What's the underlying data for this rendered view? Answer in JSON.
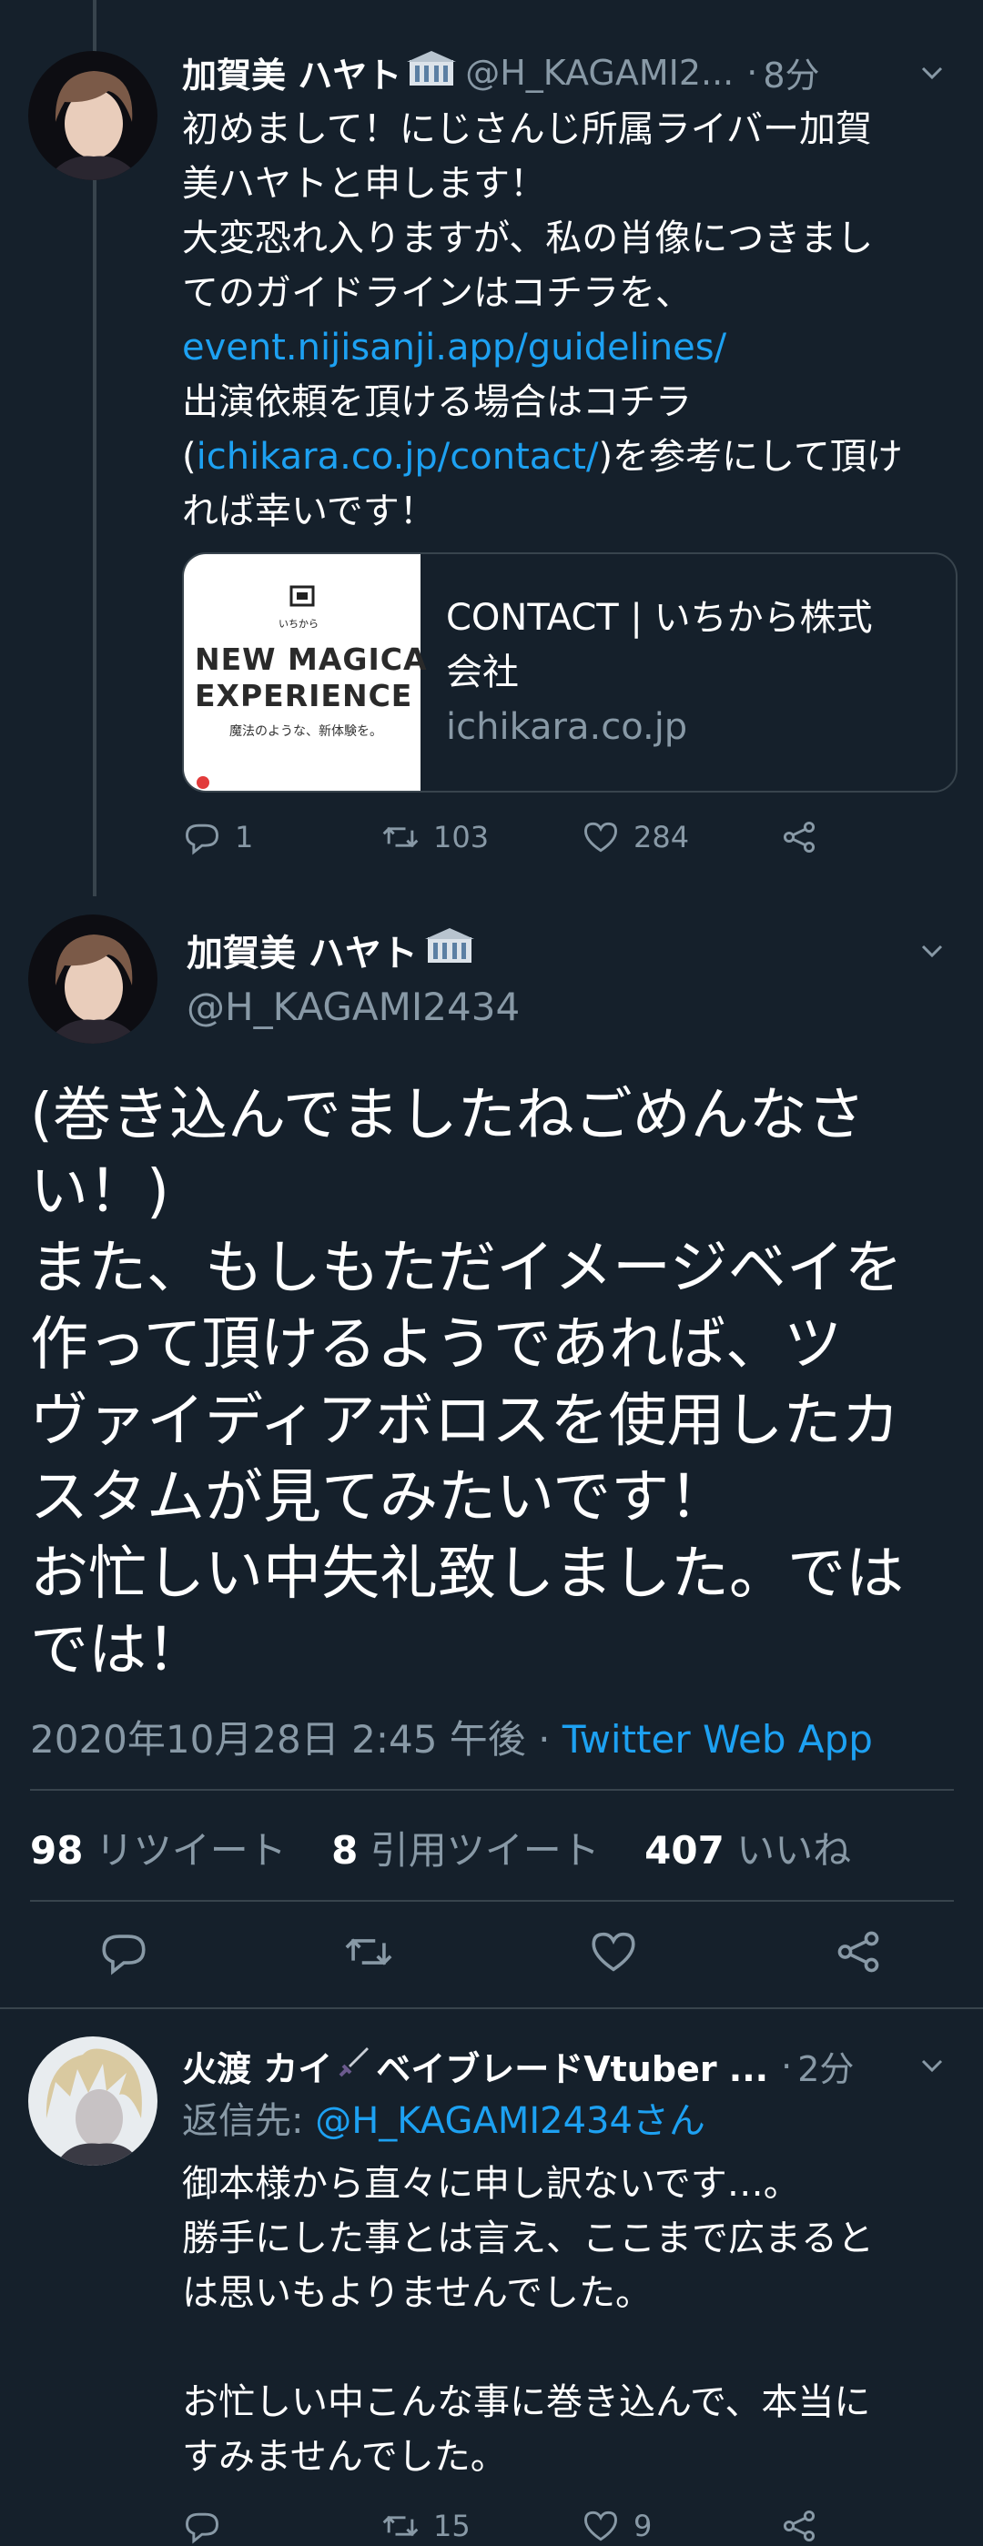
{
  "tweet1": {
    "name": "加賀美 ハヤト",
    "handle": "@H_KAGAMI2...",
    "dot": "·",
    "time": "8分",
    "lines": [
      "初めまして！にじさんじ所属ライバー加賀",
      "美ハヤトと申します！",
      "大変恐れ入りますが、私の肖像につきまし",
      "てのガイドラインはコチラを、"
    ],
    "link1": "event.nijisanji.app/guidelines/",
    "line5": "出演依頼を頂ける場合はコチラ",
    "line6_pre": "(",
    "link2": "ichikara.co.jp/contact/",
    "line6_post": ")を参考にして頂け",
    "line7": "れば幸いです！",
    "card": {
      "image_line1": "NEW MAGICA",
      "image_line2": "EXPERIENCE",
      "image_sub": "魔法のような、新体験を。",
      "image_logo": "いちから",
      "title_line1": "CONTACT | いちから株式",
      "title_line2": "会社",
      "domain": "ichikara.co.jp"
    },
    "replies": "1",
    "retweets": "103",
    "likes": "284"
  },
  "tweet2": {
    "name": "加賀美 ハヤト",
    "handle": "@H_KAGAMI2434",
    "lines": [
      "(巻き込んでましたねごめんなさ",
      "い！)",
      "また、もしもただイメージベイを",
      "作って頂けるようであれば、ツ",
      "ヴァイディアボロスを使用したカ",
      "スタムが見てみたいです！",
      "お忙しい中失礼致しました。では",
      "では！"
    ],
    "timestamp": "2020年10月28日 2:45 午後",
    "meta_sep": " · ",
    "source": "Twitter Web App",
    "retweet_count": "98",
    "retweet_label": " リツイート",
    "quote_count": "8",
    "quote_label": " 引用ツイート",
    "like_count": "407",
    "like_label": " いいね"
  },
  "tweet3": {
    "name": "火渡 カイ",
    "name_suffix": "ベイブレードVtuber ...",
    "dot": "·",
    "time": "2分",
    "reply_prefix": "返信先: ",
    "reply_handle": "@H_KAGAMI2434さん",
    "lines": [
      "御本様から直々に申し訳ないです…。",
      "勝手にした事とは言え、ここまで広まると",
      "は思いもよりませんでした。",
      "",
      "お忙しい中こんな事に巻き込んで、本当に",
      "すみませんでした。"
    ],
    "replies": "",
    "retweets": "15",
    "likes": "9"
  },
  "colors": {
    "background": "#15202b",
    "text": "#ffffff",
    "secondary": "#8899a6",
    "link": "#1da1f2",
    "border": "#38444d"
  },
  "icons": [
    "reply-icon",
    "retweet-icon",
    "like-icon",
    "share-icon",
    "chevron-down-icon",
    "building-icon",
    "sword-icon"
  ]
}
